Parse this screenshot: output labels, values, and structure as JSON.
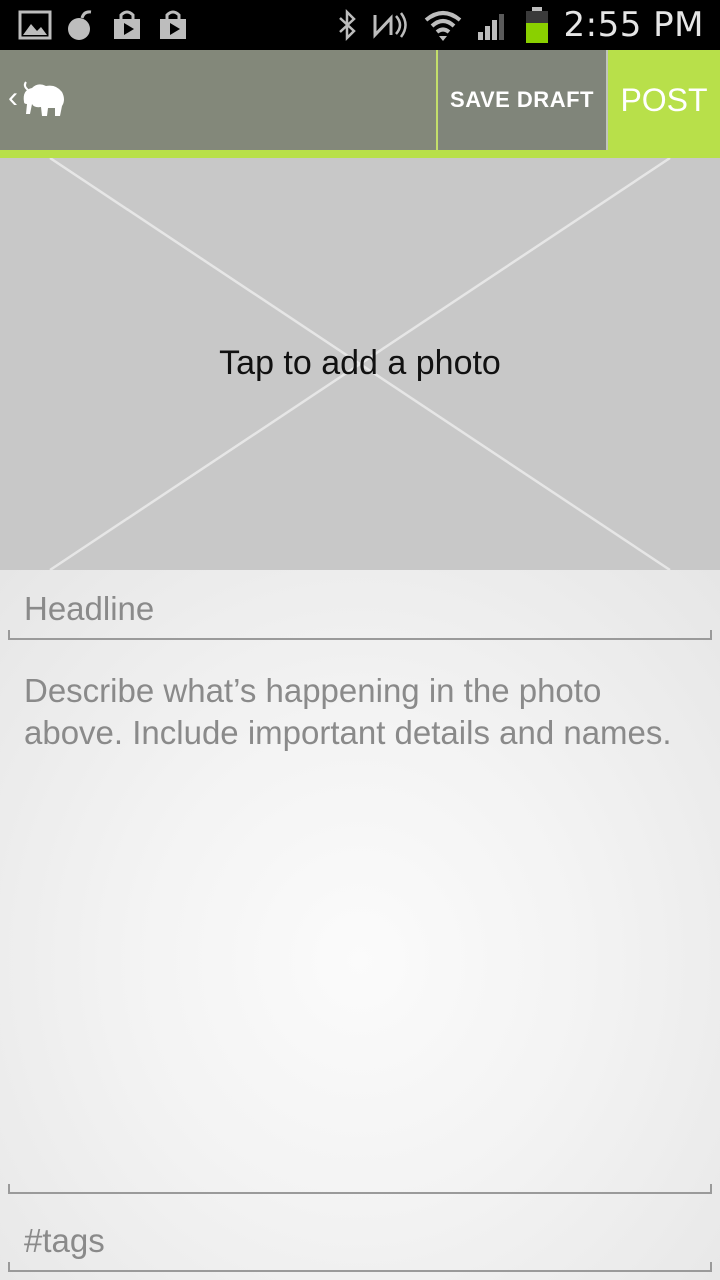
{
  "status_bar": {
    "time": "2:55 PM",
    "battery_color": "#8ad000"
  },
  "action_bar": {
    "save_draft_label": "SAVE DRAFT",
    "post_label": "POST",
    "accent_color": "#b8e04a"
  },
  "photo": {
    "prompt": "Tap to add a photo"
  },
  "form": {
    "headline_placeholder": "Headline",
    "description_placeholder": "Describe what’s happening in the photo above. Include important details and names.",
    "tags_placeholder": "#tags"
  }
}
